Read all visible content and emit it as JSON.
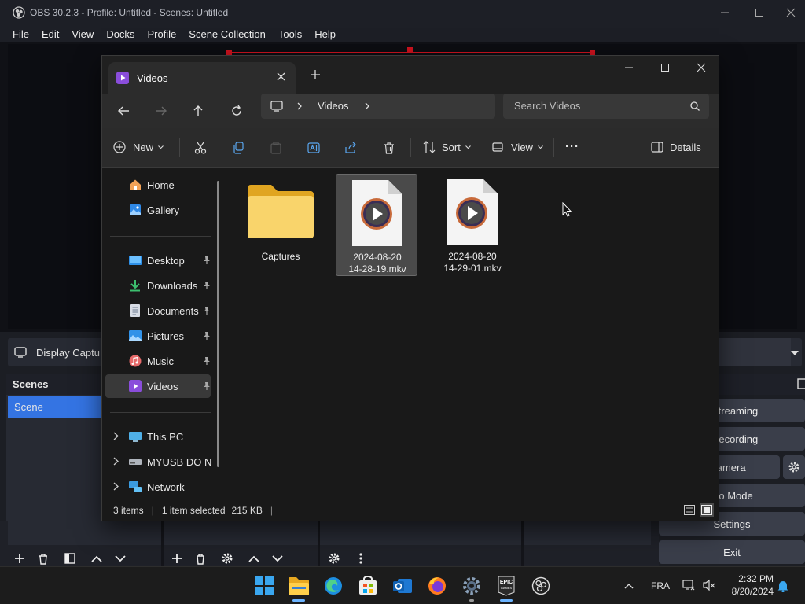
{
  "obs": {
    "title": "OBS 30.2.3 - Profile: Untitled - Scenes: Untitled",
    "menu": [
      "File",
      "Edit",
      "View",
      "Docks",
      "Profile",
      "Scene Collection",
      "Tools",
      "Help"
    ],
    "source_label": "Display Captu",
    "scenes_header": "Scenes",
    "scene_item": "Scene",
    "controls": {
      "streaming": "t Streaming",
      "recording": "t Recording",
      "virtual_camera": "ual Camera",
      "studio_mode": "dio Mode",
      "settings": "Settings",
      "exit": "Exit"
    }
  },
  "explorer": {
    "tab_title": "Videos",
    "breadcrumb": "Videos",
    "search_placeholder": "Search Videos",
    "toolbar": {
      "new": "New",
      "sort": "Sort",
      "view": "View",
      "more": "···",
      "details": "Details"
    },
    "nav": {
      "home": "Home",
      "gallery": "Gallery",
      "desktop": "Desktop",
      "downloads": "Downloads",
      "documents": "Documents",
      "pictures": "Pictures",
      "music": "Music",
      "videos": "Videos",
      "this_pc": "This PC",
      "usb": "MYUSB DO NO",
      "network": "Network"
    },
    "files": [
      {
        "name": "Captures",
        "type": "folder"
      },
      {
        "name": "2024-08-20 14-28-19.mkv",
        "line1": "2024-08-20",
        "line2": "14-28-19.mkv",
        "type": "video",
        "selected": true
      },
      {
        "name": "2024-08-20 14-29-01.mkv",
        "line1": "2024-08-20",
        "line2": "14-29-01.mkv",
        "type": "video",
        "selected": false
      }
    ],
    "status": {
      "items": "3 items",
      "selected": "1 item selected",
      "size": "215 KB"
    }
  },
  "taskbar": {
    "language": "FRA",
    "time": "2:32 PM",
    "date": "8/20/2024"
  },
  "colors": {
    "accent_blue": "#3474e3",
    "obs_red": "#d3131f",
    "folder_yellow": "#f5c342",
    "selection": "#4a4a4a"
  }
}
